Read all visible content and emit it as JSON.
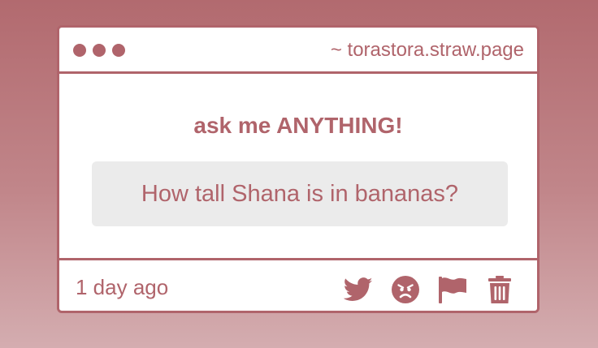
{
  "window": {
    "url": "~ torastora.straw.page"
  },
  "main": {
    "heading": "ask me ANYTHING!",
    "question": "How tall Shana is in bananas?"
  },
  "footer": {
    "timestamp": "1 day ago",
    "actions": [
      {
        "icon": "twitter-icon"
      },
      {
        "icon": "angry-face-icon"
      },
      {
        "icon": "flag-icon"
      },
      {
        "icon": "trash-icon"
      }
    ]
  },
  "colors": {
    "accent": "#b0646b",
    "background_top": "#b26a6f",
    "background_bottom": "#d4adb0",
    "card": "#ffffff",
    "question_box": "#ebebeb"
  }
}
